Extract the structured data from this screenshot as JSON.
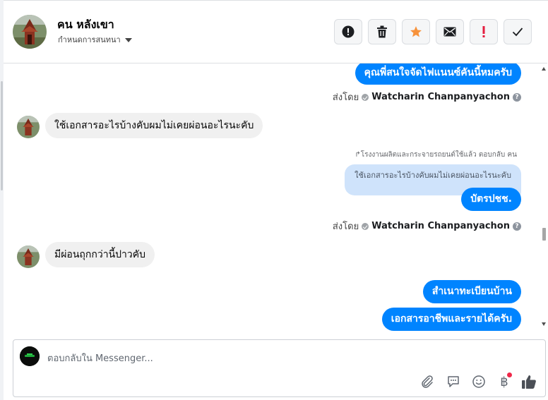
{
  "header": {
    "contact_name": "คน หลังเขา",
    "contact_subtitle": "กำหนดการสนทนา",
    "actions": [
      {
        "icon": "exclamation-circle-icon",
        "label": "report"
      },
      {
        "icon": "trash-icon",
        "label": "delete"
      },
      {
        "icon": "star-icon",
        "label": "star",
        "color": "#f7923b"
      },
      {
        "icon": "envelope-icon",
        "label": "mark unread"
      },
      {
        "icon": "exclamation-icon",
        "label": "spam",
        "color": "#e41e3f"
      },
      {
        "icon": "checkmark-icon",
        "label": "done"
      }
    ]
  },
  "messages": {
    "m1_text": "คุณพี่สนใจจัดไฟแนนซ์คันนี้หมครับ",
    "sent_by_label": "ส่งโดย",
    "sender_name": "Watcharin Chanpanyachon",
    "help_glyph": "?",
    "m2_text": "ใช้เอกสารอะไรบ้างคับผมไม่เคยผ่อนอะไรนะคับ",
    "reply_note": "↱โรงงานผลิตและกระจายรถยนต์ใช้แล้ว ตอบกลับ ฅน",
    "quoted_text": "ใช้เอกสารอะไรบ้างคับผมไม่เคยผ่อนอะไรนะคับ",
    "m3_text": "บัตรปชช.",
    "m4_text": "มีผ่อนถุกกว่านี้ปาวคับ",
    "m5_text": "สำเนาทะเบียนบ้าน",
    "m6_text": "เอกสารอาชีพและรายได้ครับ"
  },
  "composer": {
    "placeholder": "ตอบกลับใน Messenger...",
    "baht_glyph": "฿",
    "tools": [
      "paperclip-icon",
      "speech-bubble-icon",
      "emoji-icon",
      "baht-icon",
      "thumbs-up-icon"
    ]
  },
  "colors": {
    "accent": "#0084ff",
    "incoming_bubble": "#f0f0f0",
    "quoted_bubble": "#cfe3fb",
    "notification_dot": "#f02849"
  }
}
